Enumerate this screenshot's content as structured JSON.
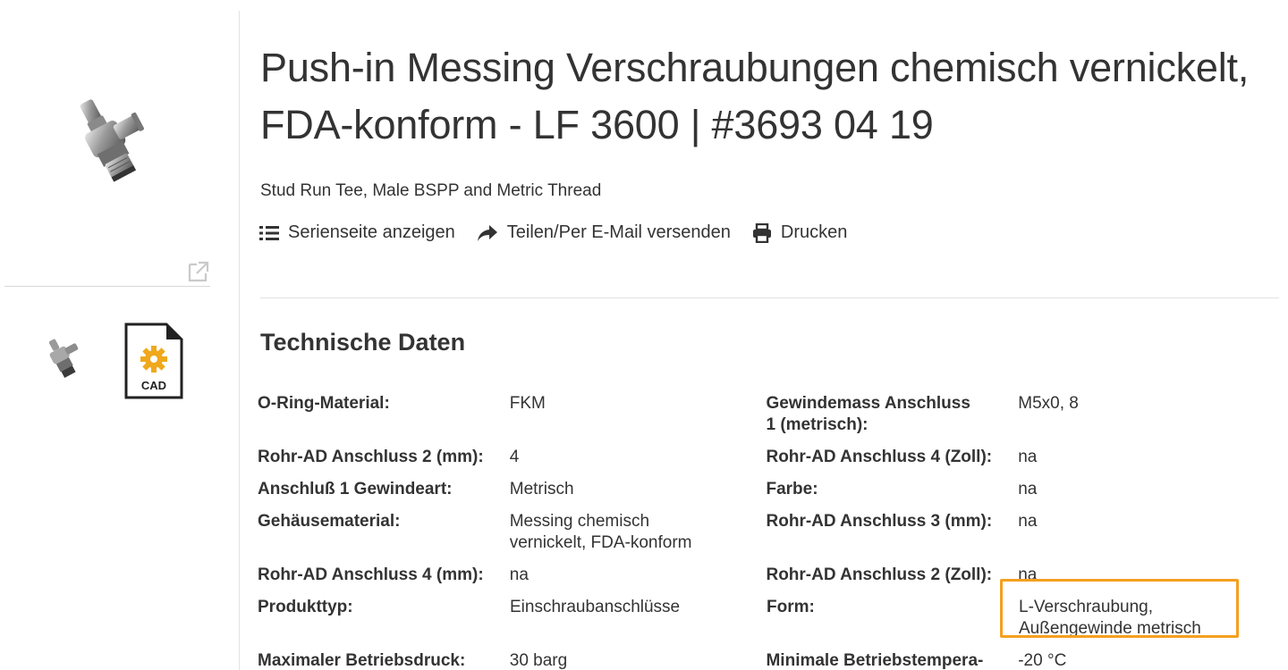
{
  "product": {
    "title": "Push-in Messing Verschraubungen chemisch vernickelt, FDA-konform - LF 3600 | #3693 04 19",
    "subtitle": "Stud Run Tee, Male BSPP and Metric Thread"
  },
  "gallery": {
    "cad_label": "CAD",
    "icons": [
      "open-in-new-icon",
      "cad-file-icon"
    ]
  },
  "actions": [
    {
      "label": "Serienseite anzeigen",
      "icon": "list-icon"
    },
    {
      "label": "Teilen/Per E-Mail versenden",
      "icon": "share-icon"
    },
    {
      "label": "Drucken",
      "icon": "print-icon"
    }
  ],
  "section": {
    "title": "Technische Daten"
  },
  "specs": [
    {
      "label1": "O-Ring-Material:",
      "value1": "FKM",
      "label2": "Gewindemass Anschluss 1 (metrisch):",
      "value2": "M5x0, 8"
    },
    {
      "label1": "Rohr-AD Anschluss 2 (mm):",
      "value1": "4",
      "label2": "Rohr-AD Anschluss 4 (Zoll):",
      "value2": "na"
    },
    {
      "label1": "Anschluß 1 Gewindeart:",
      "value1": "Metrisch",
      "label2": "Farbe:",
      "value2": "na"
    },
    {
      "label1": "Gehäusematerial:",
      "value1": "Messing chemisch vernickelt, FDA-konform",
      "label2": "Rohr-AD Anschluss 3 (mm):",
      "value2": "na"
    },
    {
      "label1": "Rohr-AD Anschluss 4 (mm):",
      "value1": "na",
      "label2": "Rohr-AD Anschluss 2 (Zoll):",
      "value2": "na"
    },
    {
      "label1": "Produkttyp:",
      "value1": "Einschraubanschlüsse",
      "label2": "Form:",
      "value2": "L-Verschraubung, Außengewinde metrisch"
    },
    {
      "label1": "Maximaler Betriebsdruck:",
      "value1": "30 barg",
      "label2": "Minimale Betriebstempera-",
      "value2": "-20 °C"
    }
  ],
  "colors": {
    "highlight": "#f5a020",
    "cad_gear": "#f0a81c",
    "text": "#333333"
  }
}
